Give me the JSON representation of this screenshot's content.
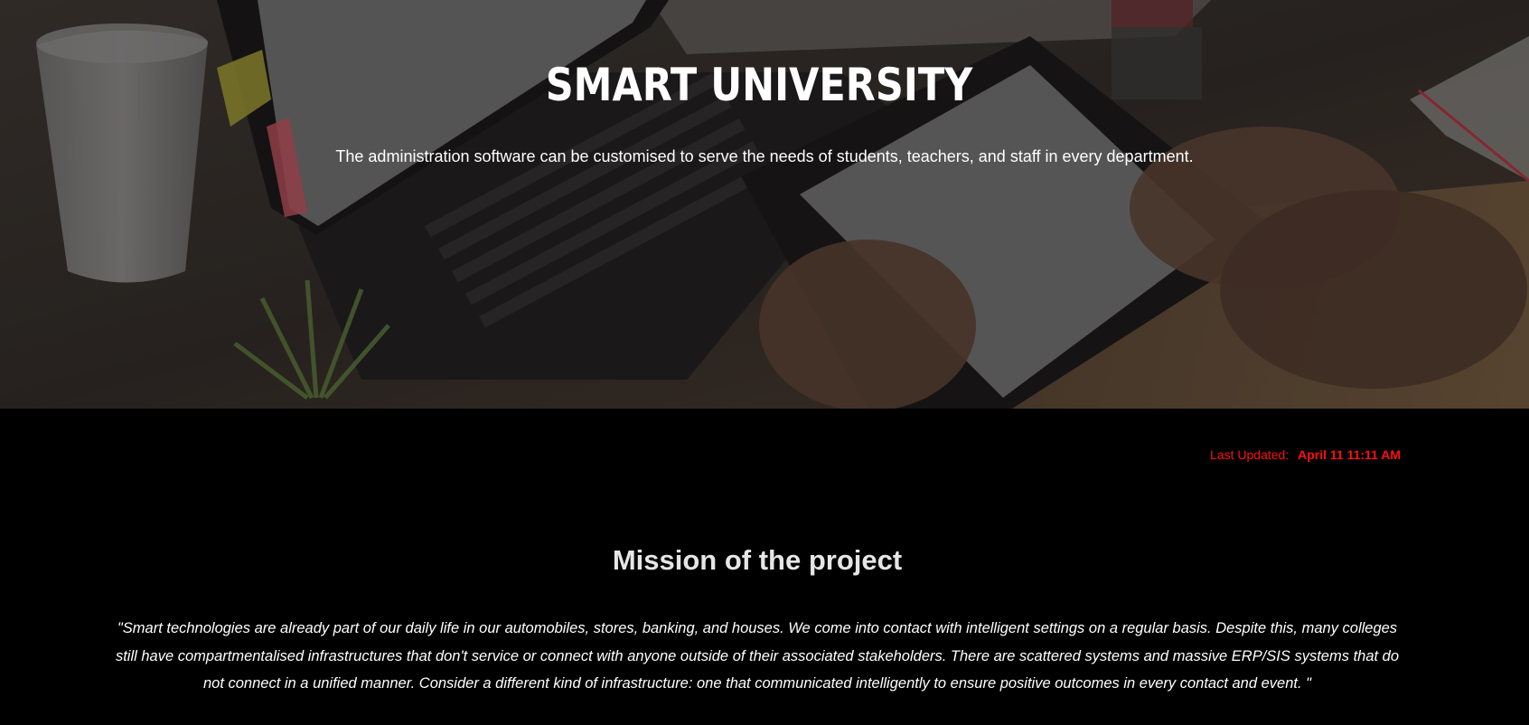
{
  "hero": {
    "title": "SMART UNIVERSITY",
    "subtitle": "The administration software can be customised to serve the needs of students, teachers, and staff in every department."
  },
  "last_updated": {
    "label": "Last Updated:",
    "value": "April 11 11:11 AM",
    "color": "#ff1010"
  },
  "mission": {
    "heading": "Mission of the project",
    "quote": "\"Smart technologies are already part of our daily life in our automobiles, stores, banking, and houses. We come into contact with intelligent settings on a regular basis. Despite this, many colleges still have compartmentalised infrastructures that don't service or connect with anyone outside of their associated stakeholders. There are scattered systems and massive ERP/SIS systems that do not connect in a unified manner. Consider a different kind of infrastructure: one that communicated intelligently to ensure positive outcomes in every contact and event. \""
  },
  "colors": {
    "page_background": "#000000",
    "accent": "#ff1010"
  }
}
